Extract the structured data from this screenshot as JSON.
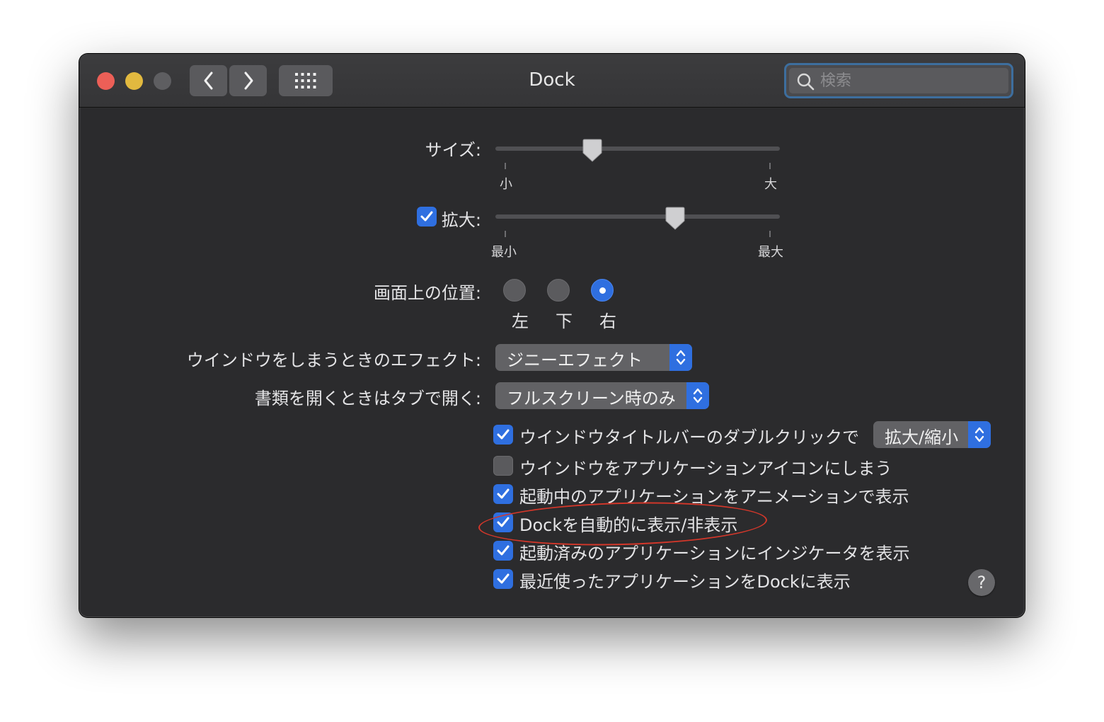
{
  "window": {
    "title": "Dock"
  },
  "search": {
    "placeholder": "検索"
  },
  "size": {
    "label": "サイズ:",
    "min_label": "小",
    "max_label": "大",
    "value": 0.33
  },
  "magnification": {
    "label": "拡大:",
    "checked": true,
    "min_label": "最小",
    "max_label": "最大",
    "value": 0.64
  },
  "position": {
    "label": "画面上の位置:",
    "options": [
      "左",
      "下",
      "右"
    ],
    "selected": "右"
  },
  "minimize_effect": {
    "label": "ウインドウをしまうときのエフェクト:",
    "value": "ジニーエフェクト"
  },
  "tabs_pref": {
    "label": "書類を開くときはタブで開く:",
    "value": "フルスクリーン時のみ"
  },
  "double_click": {
    "label": "ウインドウタイトルバーのダブルクリックで",
    "checked": true,
    "value": "拡大/縮小"
  },
  "checkboxes": [
    {
      "label": "ウインドウをアプリケーションアイコンにしまう",
      "checked": false
    },
    {
      "label": "起動中のアプリケーションをアニメーションで表示",
      "checked": true
    },
    {
      "label": "Dockを自動的に表示/非表示",
      "checked": true
    },
    {
      "label": "起動済みのアプリケーションにインジケータを表示",
      "checked": true
    },
    {
      "label": "最近使ったアプリケーションをDockに表示",
      "checked": true
    }
  ],
  "help": {
    "label": "?"
  },
  "colors": {
    "accent": "#2f6fe0",
    "annotation": "#d4372a",
    "background": "#2b2b2d"
  }
}
